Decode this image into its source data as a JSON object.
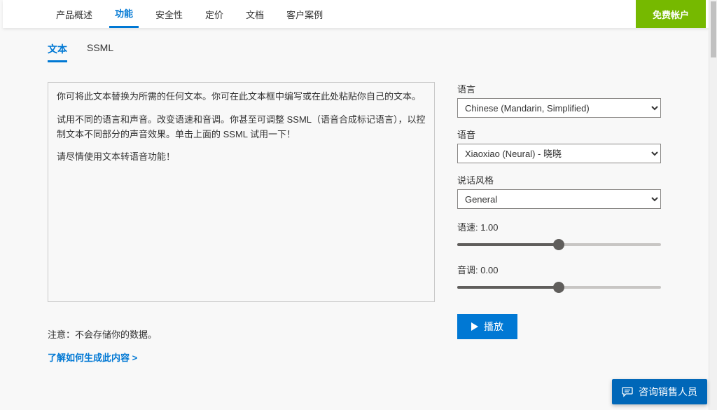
{
  "topnav": {
    "items": [
      {
        "label": "产品概述"
      },
      {
        "label": "功能"
      },
      {
        "label": "安全性"
      },
      {
        "label": "定价"
      },
      {
        "label": "文档"
      },
      {
        "label": "客户案例"
      }
    ],
    "active_index": 1,
    "cta_label": "免费帐户"
  },
  "format_tabs": {
    "items": [
      {
        "label": "文本"
      },
      {
        "label": "SSML"
      }
    ],
    "active_index": 0
  },
  "text_input": {
    "p1": "你可将此文本替换为所需的任何文本。你可在此文本框中编写或在此处粘贴你自己的文本。",
    "p2": "试用不同的语言和声音。改变语速和音调。你甚至可调整 SSML（语音合成标记语言），以控制文本不同部分的声音效果。单击上面的 SSML 试用一下！",
    "p3": "请尽情使用文本转语音功能！"
  },
  "controls": {
    "language": {
      "label": "语言",
      "value": "Chinese (Mandarin, Simplified)"
    },
    "voice": {
      "label": "语音",
      "value": "Xiaoxiao (Neural) - 晓晓"
    },
    "style": {
      "label": "说话风格",
      "value": "General"
    },
    "speed": {
      "label": "语速: 1.00",
      "value": 1.0,
      "fill_pct": 50
    },
    "pitch": {
      "label": "音调: 0.00",
      "value": 0.0,
      "fill_pct": 50
    },
    "play_label": "播放"
  },
  "footer": {
    "note": "注意：不会存储你的数据。",
    "learn_link": "了解如何生成此内容 >"
  },
  "chat": {
    "label": "咨询销售人员"
  }
}
